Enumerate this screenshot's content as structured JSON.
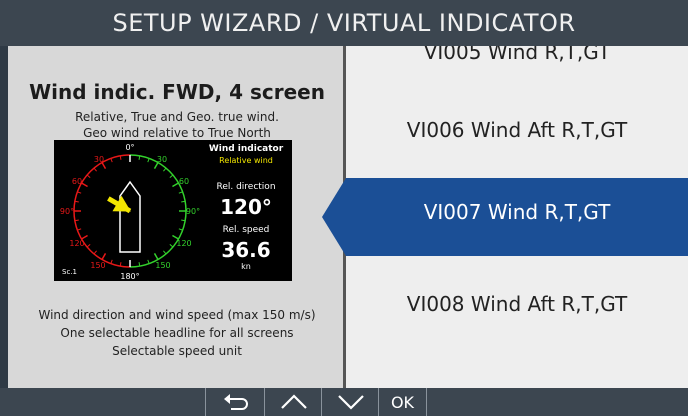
{
  "title": "SETUP WIZARD / VIRTUAL INDICATOR",
  "details": {
    "heading": "Wind indic. FWD, 4 screen",
    "sub_line1": "Relative, True and Geo. true wind.",
    "sub_line2": "Geo wind relative to True North",
    "preview": {
      "panel_title": "Wind indicator",
      "mode": "Relative wind",
      "direction_label": "Rel. direction",
      "direction_value": "120°",
      "speed_label": "Rel. speed",
      "speed_value": "36.6",
      "speed_unit": "kn",
      "scale_label": "Sc.1",
      "dial": {
        "labels": {
          "top": "0°",
          "bottom": "180°",
          "right": "90°",
          "left": "90°",
          "r30": "30",
          "r60": "60",
          "r120": "120",
          "r150": "150",
          "l30": "30",
          "l60": "60",
          "l120": "120",
          "l150": "150"
        },
        "pointer_deg": 120
      },
      "colors": {
        "port": "#e81818",
        "starboard": "#33d12c",
        "pointer": "#f2e600"
      }
    },
    "bottom_line1": "Wind direction and wind speed (max 150 m/s)",
    "bottom_line2": "One selectable headline for all screens",
    "bottom_line3": "Selectable speed unit"
  },
  "list": {
    "items": [
      {
        "label": "VI005 Wind R,T,GT",
        "selected": false
      },
      {
        "label": "VI006 Wind Aft R,T,GT",
        "selected": false
      },
      {
        "label": "VI007 Wind R,T,GT",
        "selected": true
      },
      {
        "label": "VI008 Wind Aft R,T,GT",
        "selected": false
      }
    ],
    "selection_color": "#1b4f96"
  },
  "softkeys": {
    "back_icon": "return-arrow-icon",
    "up_icon": "chevron-up-icon",
    "down_icon": "chevron-down-icon",
    "ok_label": "OK"
  }
}
